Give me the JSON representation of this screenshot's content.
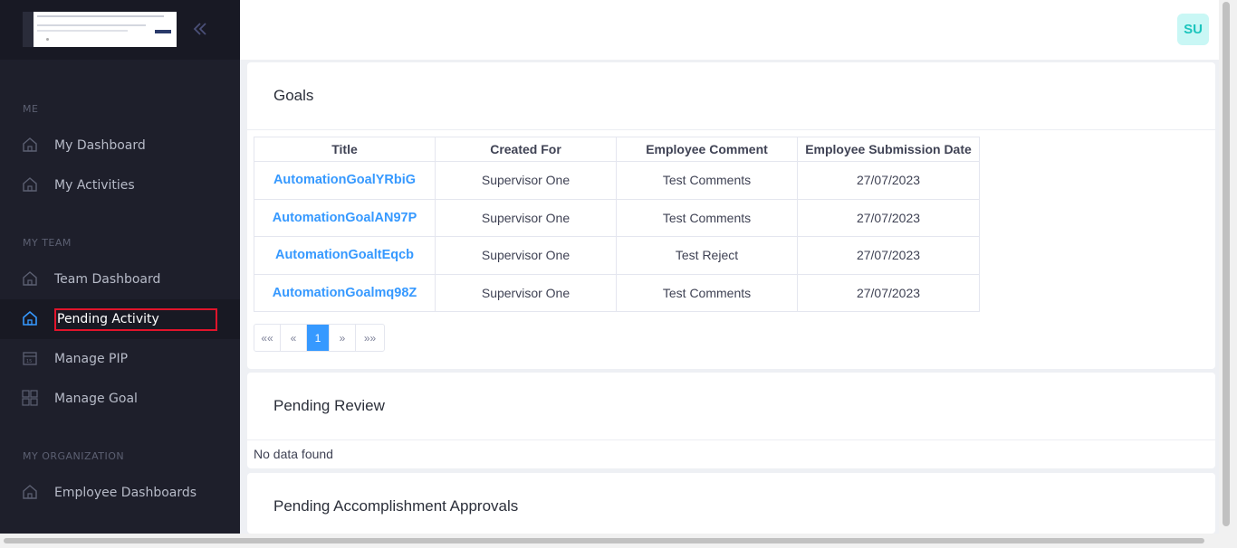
{
  "sidebar": {
    "sections": [
      {
        "label": "ME"
      },
      {
        "label": "MY TEAM"
      },
      {
        "label": "MY ORGANIZATION"
      }
    ],
    "items": [
      {
        "label": "My Dashboard",
        "icon": "home-icon"
      },
      {
        "label": "My Activities",
        "icon": "home-icon"
      },
      {
        "label": "Team Dashboard",
        "icon": "home-icon"
      },
      {
        "label": "Pending Activity",
        "icon": "home-icon",
        "active": true
      },
      {
        "label": "Manage PIP",
        "icon": "calendar-icon"
      },
      {
        "label": "Manage Goal",
        "icon": "grid-icon"
      },
      {
        "label": "Employee Dashboards",
        "icon": "home-icon"
      }
    ]
  },
  "header": {
    "avatar_initials": "SU",
    "avatar_color": "#1bc5bd"
  },
  "goals": {
    "title": "Goals",
    "columns": [
      "Title",
      "Created For",
      "Employee Comment",
      "Employee Submission Date"
    ],
    "rows": [
      {
        "title": "AutomationGoalYRbiG",
        "created_for": "Supervisor One",
        "comment": "Test Comments",
        "date": "27/07/2023"
      },
      {
        "title": "AutomationGoalAN97P",
        "created_for": "Supervisor One",
        "comment": "Test Comments",
        "date": "27/07/2023"
      },
      {
        "title": "AutomationGoaltEqcb",
        "created_for": "Supervisor One",
        "comment": "Test Reject",
        "date": "27/07/2023"
      },
      {
        "title": "AutomationGoalmq98Z",
        "created_for": "Supervisor One",
        "comment": "Test Comments",
        "date": "27/07/2023"
      }
    ],
    "pagination": {
      "first": "««",
      "prev": "«",
      "current": "1",
      "next": "»",
      "last": "»»"
    }
  },
  "pending_review": {
    "title": "Pending Review",
    "empty_text": "No data found"
  },
  "pending_accomplishment": {
    "title": "Pending Accomplishment Approvals"
  },
  "colors": {
    "sidebar_bg": "#1e1f2b",
    "link_blue": "#3699ff",
    "highlight_red": "#e0142b"
  }
}
